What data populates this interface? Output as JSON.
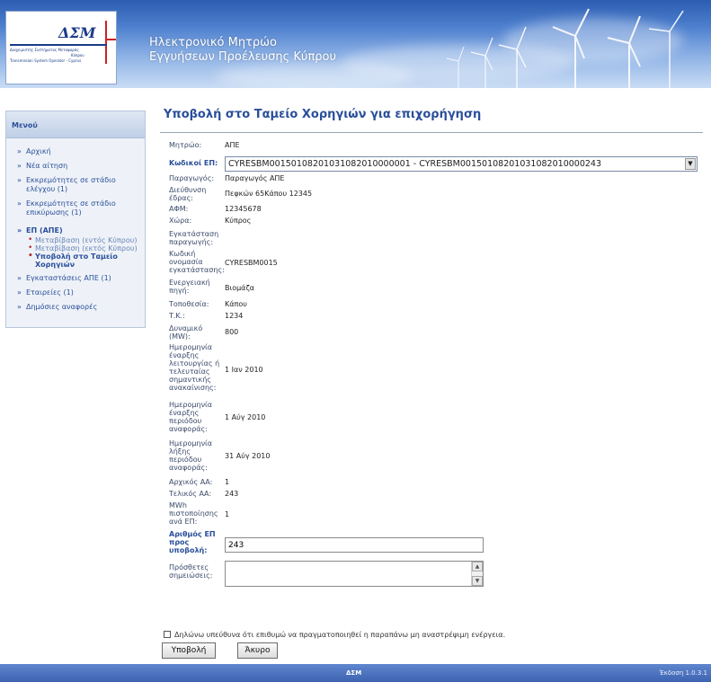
{
  "header": {
    "logo_mark": "ΔΣΜ",
    "logo_line1": "Διαχειριστής Συστήματος Μεταφοράς",
    "logo_line2": "Κύπρου",
    "logo_line3": "Transmission System Operator - Cyprus",
    "title_line1": "Ηλεκτρονικό Μητρώο",
    "title_line2": "Εγγυήσεων Προέλευσης Κύπρου"
  },
  "sidebar": {
    "heading": "Μενού",
    "items": [
      {
        "label": "Αρχική"
      },
      {
        "label": "Νέα αίτηση"
      },
      {
        "label": "Εκκρεμότητες σε στάδιο ελέγχου (1)"
      },
      {
        "label": "Εκκρεμότητες σε στάδιο επικύρωσης (1)"
      },
      {
        "label": "ΕΠ (ΑΠΕ)"
      },
      {
        "label": "Εγκαταστάσεις ΑΠΕ (1)"
      },
      {
        "label": "Εταιρείες (1)"
      },
      {
        "label": "Δημόσιες αναφορές"
      }
    ],
    "subitems": [
      {
        "label": "Μεταβίβαση (εντός Κύπρου)"
      },
      {
        "label": "Μεταβίβαση (εκτός Κύπρου)"
      },
      {
        "label": "Υποβολή στο Ταμείο Χορηγιών"
      }
    ]
  },
  "main": {
    "title": "Υποβολή στο Ταμείο Χορηγιών για επιχορήγηση",
    "fields": {
      "registry": {
        "label": "Μητρώο:",
        "value": "ΑΠΕ"
      },
      "codes": {
        "label": "Κωδικοί ΕΠ:",
        "value": "CYRESBM0015010820103108201000000​1 - CYRESBM00150108201031082010000243"
      },
      "producer": {
        "label": "Παραγωγός:",
        "value": "Παραγωγός ΑΠΕ"
      },
      "address": {
        "label": "Διεύθυνση έδρας:",
        "value": "Πεφκών 65Κάπου 12345"
      },
      "afm": {
        "label": "ΑΦΜ:",
        "value": "12345678"
      },
      "country": {
        "label": "Χώρα:",
        "value": "Κύπρος"
      },
      "installation": {
        "label": "Εγκατάσταση παραγωγής:",
        "value": ""
      },
      "install_code": {
        "label": "Κωδική ονομασία εγκατάστασης:",
        "value": "CYRESBM0015"
      },
      "energy_source": {
        "label": "Ενεργειακή πηγή:",
        "value": "Βιομάζα"
      },
      "location": {
        "label": "Τοποθεσία:",
        "value": "Κάπου"
      },
      "postcode": {
        "label": "Τ.Κ.:",
        "value": "1234"
      },
      "capacity": {
        "label": "Δυναμικό (MW):",
        "value": "800"
      },
      "start_date": {
        "label": "Ημερομηνία έναρξης λειτουργίας ή τελευταίας σημαντικής ανακαίνισης:",
        "value": "1 Ιαν 2010"
      },
      "period_start": {
        "label": "Ημερομηνία έναρξης περιόδου αναφοράς:",
        "value": "1 Αύγ 2010"
      },
      "period_end": {
        "label": "Ημερομηνία λήξης περιόδου αναφοράς:",
        "value": "31 Αύγ 2010"
      },
      "first_no": {
        "label": "Αρχικός ΑΑ:",
        "value": "1"
      },
      "last_no": {
        "label": "Τελικός ΑΑ:",
        "value": "243"
      },
      "mwh": {
        "label": "MWh πιστοποίησης ανά ΕΠ:",
        "value": "1"
      },
      "count": {
        "label": "Αριθμός ΕΠ προς υποβολή:",
        "value": "243"
      },
      "notes": {
        "label": "Πρόσθετες σημειώσεις:",
        "value": ""
      }
    },
    "confirm_text": "Δηλώνω υπεύθυνα ότι επιθυμώ να πραγματοποιηθεί η παραπάνω μη αναστρέψιμη ενέργεια.",
    "submit_label": "Υποβολή",
    "cancel_label": "Άκυρο"
  },
  "footer": {
    "center": "ΔΣΜ",
    "version": "Έκδοση 1.0.3.1"
  },
  "colors": {
    "accent": "#2a4f9a",
    "header_blue": "#3d63b0"
  }
}
